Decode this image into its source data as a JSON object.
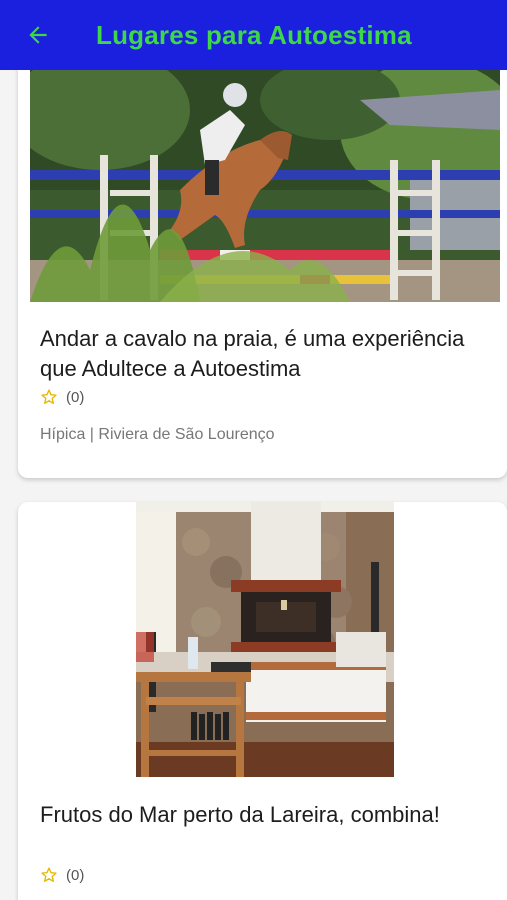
{
  "app_bar": {
    "title": "Lugares para Autoestima",
    "background": "#1b1fde",
    "title_color": "#3ed64a",
    "back_icon": "arrow-left-icon"
  },
  "cards": [
    {
      "image": "horse-jumping-photo",
      "title": "Andar a cavalo na praia, é uma experiência que Adultece a Autoestima",
      "rating_icon": "star-outline-icon",
      "rating_count": "(0)",
      "meta": "Hípica | Riviera de São Lourenço"
    },
    {
      "image": "fireplace-lounge-photo",
      "title": "Frutos do Mar perto da Lareira, combina!",
      "rating_icon": "star-outline-icon",
      "rating_count": "(0)"
    }
  ]
}
